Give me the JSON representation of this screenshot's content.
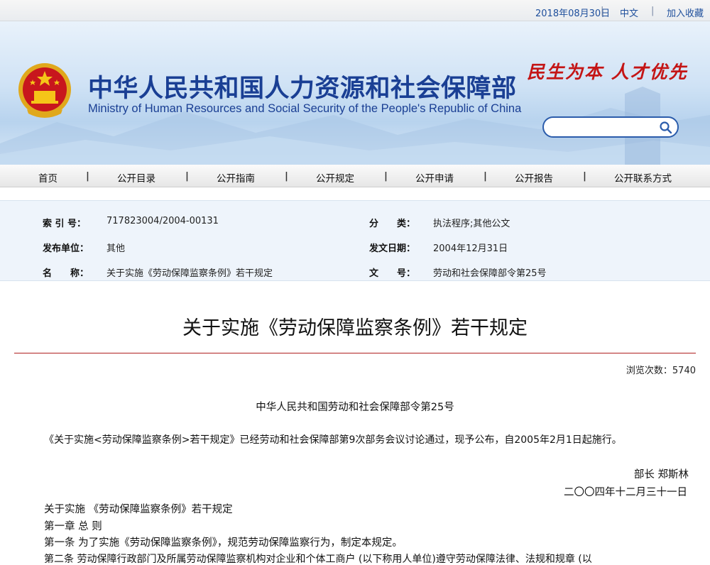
{
  "topbar": {
    "date": "2018年08月30日",
    "separator": "|",
    "language": "中文",
    "favorite": "加入收藏"
  },
  "header": {
    "title_cn": "中华人民共和国人力资源和社会保障部",
    "title_en": "Ministry of Human Resources and Social Security of the People's Republic of China",
    "slogan": "民生为本 人才优先",
    "search": {
      "placeholder": "",
      "value": ""
    }
  },
  "nav": {
    "items": [
      {
        "label": "首页"
      },
      {
        "label": "公开目录"
      },
      {
        "label": "公开指南"
      },
      {
        "label": "公开规定"
      },
      {
        "label": "公开申请"
      },
      {
        "label": "公开报告"
      },
      {
        "label": "公开联系方式"
      }
    ],
    "separator": "|"
  },
  "meta": {
    "index_label": "索 引 号：",
    "index_value": "717823004/2004-00131",
    "category_label": "分　　类：",
    "category_value": "执法程序;其他公文",
    "issuer_label": "发布单位：",
    "issuer_value": "其他",
    "date_label": "发文日期：",
    "date_value": "2004年12月31日",
    "name_label": "名　　称：",
    "name_value": "关于实施《劳动保障监察条例》若干规定",
    "doc_label": "文　　号：",
    "doc_value": "劳动和社会保障部令第25号"
  },
  "article": {
    "title": "关于实施《劳动保障监察条例》若干规定",
    "views": "浏览次数：5740",
    "order_no": "中华人民共和国劳动和社会保障部令第25号",
    "announcement": "《关于实施<劳动保障监察条例>若干规定》已经劳动和社会保障部第9次部务会议讨论通过，现予公布，自2005年2月1日起施行。",
    "signer": "部长  郑斯林",
    "sign_date": "二〇〇四年十二月三十一日",
    "lines": [
      "关于实施 《劳动保障监察条例》若干规定",
      "第一章 总 则",
      "第一条 为了实施《劳动保障监察条例》，规范劳动保障监察行为，制定本规定。",
      "第二条 劳动保障行政部门及所属劳动保障监察机构对企业和个体工商户 (以下称用人单位)遵守劳动保障法律、法规和规章 (以"
    ]
  },
  "colors": {
    "brand_blue": "#1a3f94",
    "slogan_red": "#c41515",
    "rule_red": "#b02020",
    "meta_bg": "#eef4fb"
  },
  "icons": {
    "emblem": "national-emblem",
    "search": "search-icon"
  }
}
